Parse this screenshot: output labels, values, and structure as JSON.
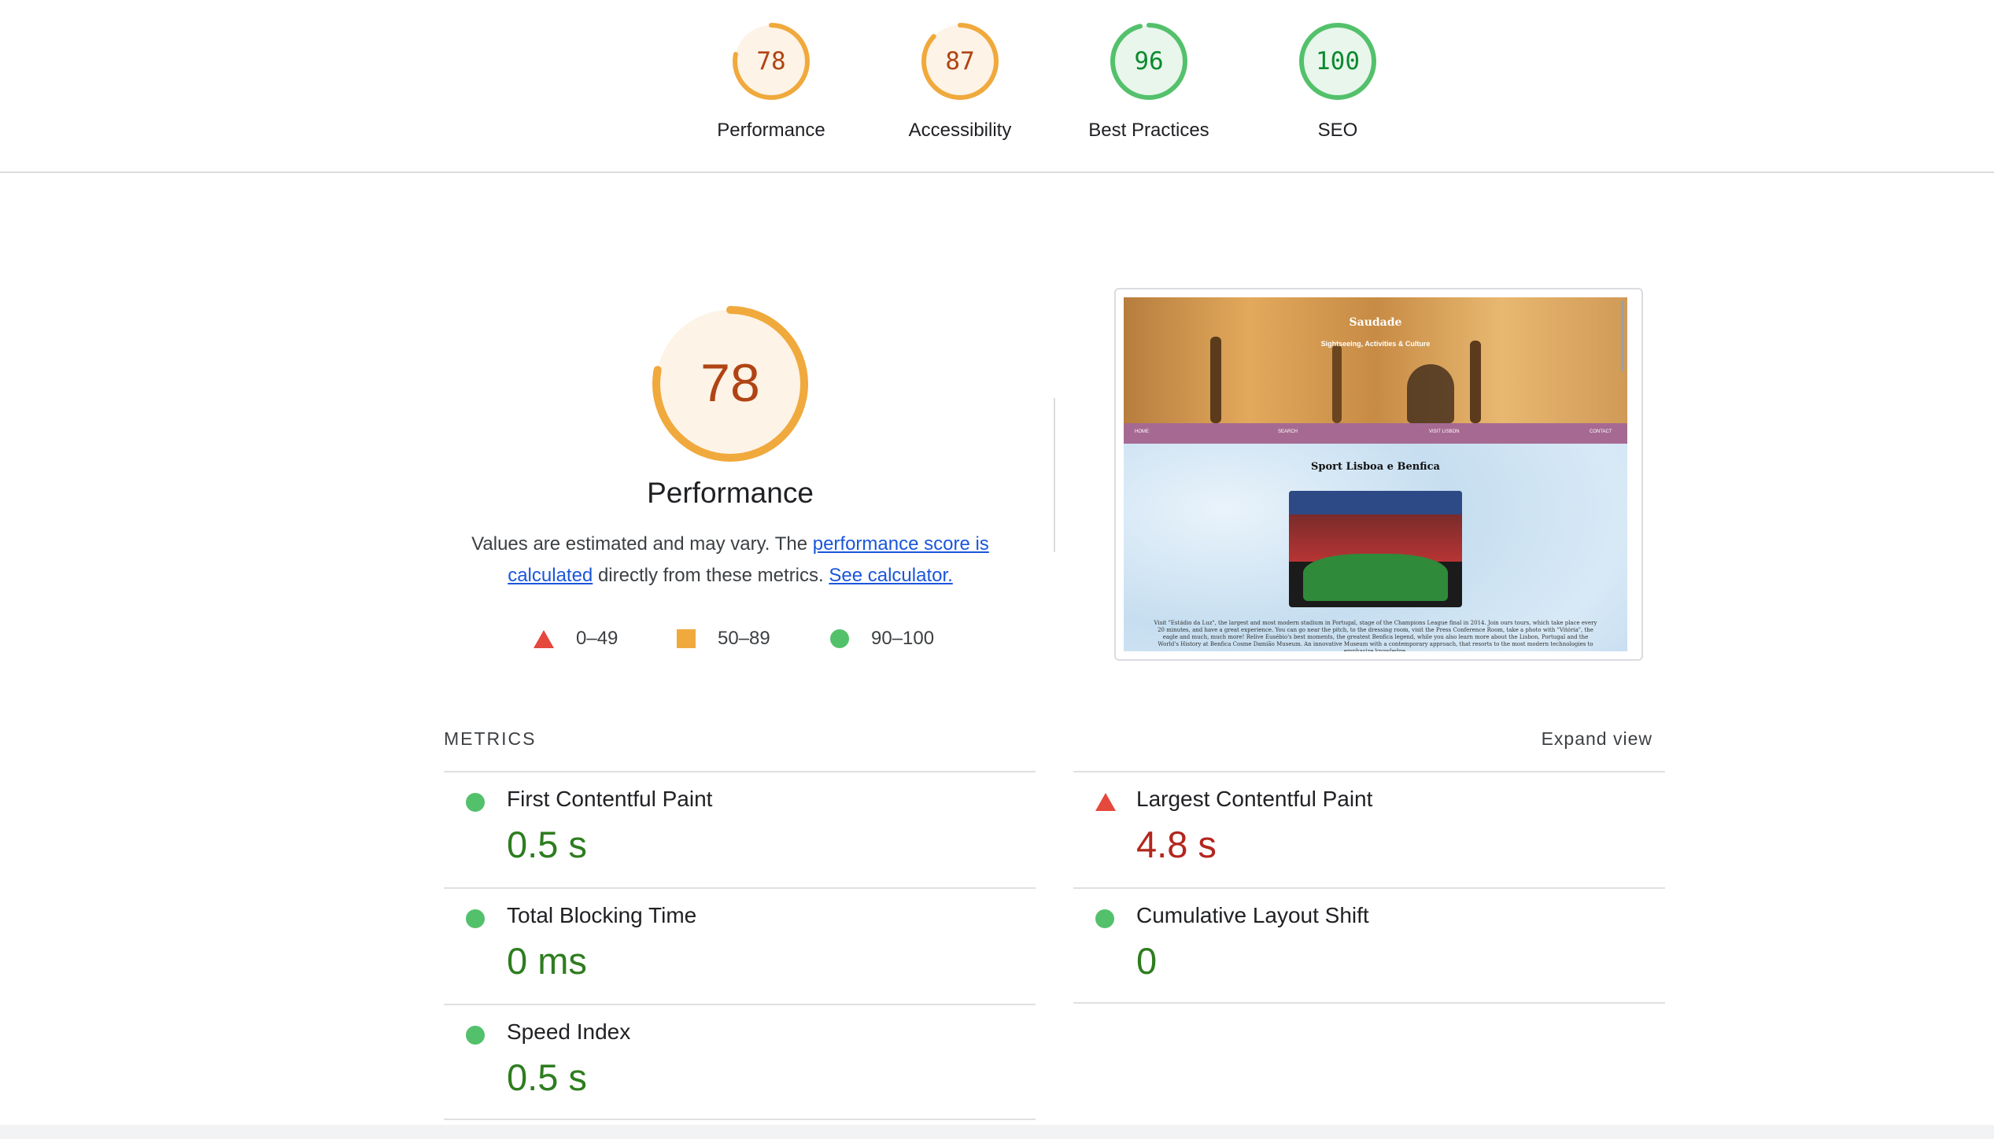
{
  "summary": {
    "items": [
      {
        "score": "78",
        "label": "Performance",
        "status": "average"
      },
      {
        "score": "87",
        "label": "Accessibility",
        "status": "average"
      },
      {
        "score": "96",
        "label": "Best Practices",
        "status": "pass"
      },
      {
        "score": "100",
        "label": "SEO",
        "status": "pass"
      }
    ]
  },
  "performance": {
    "score": "78",
    "title": "Performance",
    "desc_prefix": "Values are estimated and may vary. The ",
    "desc_link1": "performance score is calculated",
    "desc_middle": " directly from these metrics. ",
    "desc_link2": "See calculator."
  },
  "legend": {
    "fail": "0–49",
    "average": "50–89",
    "pass": "90–100"
  },
  "thumbnail": {
    "site_logo": "Saudade",
    "site_tagline": "Sightseeing, Activities & Culture",
    "nav": [
      "HOME",
      "SEARCH",
      "VISIT LISBON",
      "CONTACT"
    ],
    "heading": "Sport Lisboa e Benfica",
    "body_text": "Visit \"Estádio da Luz\", the largest and most modern stadium in Portugal, stage of the Champions League final in 2014. Join ours tours, which take place every 20 minutes, and have a great experience. You can go near the pitch, to the dressing room, visit the Press Conference Room, take a photo with \"Vitória\", the eagle and much, much more! Relive Eusébio's best moments, the greatest Benfica legend, while you also learn more about the Lisbon, Portugal and the World's History at Benfica Cosme Damião Museum. An innovative Museum with a contemporary approach, that resorts to the most modern technologies to emphasize knowledge."
  },
  "metrics": {
    "heading": "METRICS",
    "expand_label": "Expand view",
    "items": [
      {
        "title": "First Contentful Paint",
        "value": "0.5 s",
        "status": "pass"
      },
      {
        "title": "Largest Contentful Paint",
        "value": "4.8 s",
        "status": "fail"
      },
      {
        "title": "Total Blocking Time",
        "value": "0 ms",
        "status": "pass"
      },
      {
        "title": "Cumulative Layout Shift",
        "value": "0",
        "status": "pass"
      },
      {
        "title": "Speed Index",
        "value": "0.5 s",
        "status": "pass"
      }
    ]
  },
  "colors": {
    "pass": "#0c8a2e",
    "average": "#f0a93c",
    "fail": "#e5483c",
    "link": "#1a56db"
  }
}
